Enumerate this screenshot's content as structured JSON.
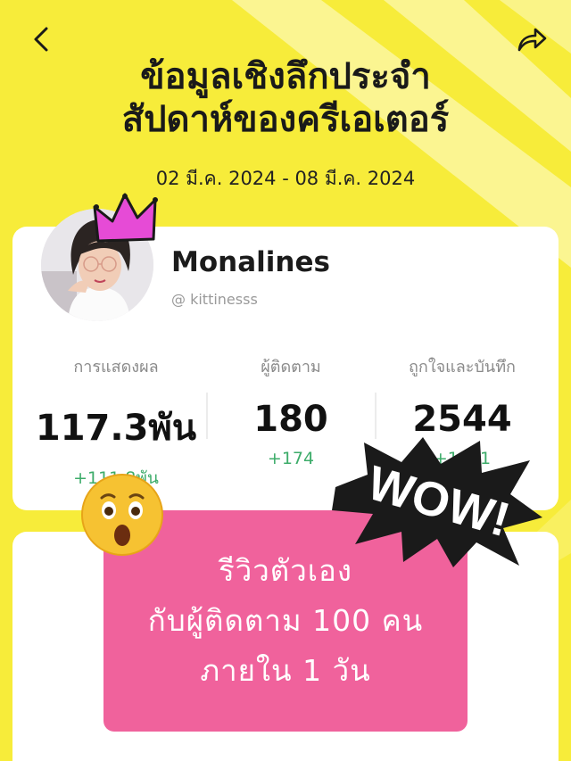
{
  "colors": {
    "background": "#f7ec3a",
    "ray": "#fbf8a8",
    "card": "#ffffff",
    "delta_green": "#3dac6a",
    "promo_pink": "#f0629c",
    "crown_pink": "#e64bd6"
  },
  "header": {
    "back_icon": "chevron-left-icon",
    "share_icon": "share-arrow-icon",
    "title_line1": "ข้อมูลเชิงลึกประจำ",
    "title_line2": "สัปดาห์ของครีเอเตอร์",
    "date_range": "02 มี.ค. 2024 - 08 มี.ค. 2024"
  },
  "profile": {
    "name": "Monalines",
    "handle": "@ kittinesss"
  },
  "stats": [
    {
      "label": "การแสดงผล",
      "value": "117.3พัน",
      "delta": "+111.8พัน"
    },
    {
      "label": "ผู้ติดตาม",
      "value": "180",
      "delta": "+174"
    },
    {
      "label": "ถูกใจและบันทึก",
      "value": "2544",
      "delta": "+1601"
    }
  ],
  "sticker": {
    "wow_text": "WOW!",
    "emoji": "astonished-face"
  },
  "promo": {
    "line1": "รีวิวตัวเอง",
    "line2": "กับผู้ติดตาม 100 คน",
    "line3": "ภายใน 1 วัน"
  }
}
